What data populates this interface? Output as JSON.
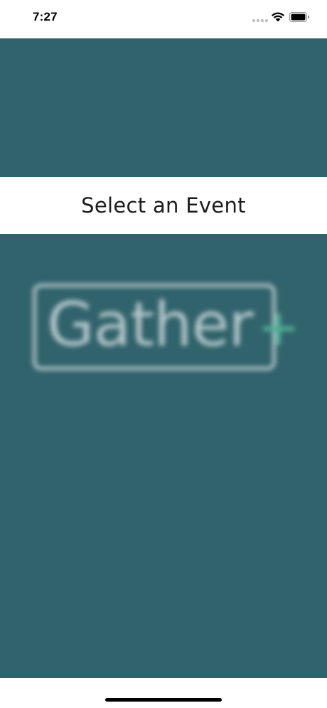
{
  "status_bar": {
    "time": "7:27",
    "icons": [
      "signal-dots-icon",
      "wifi-icon",
      "battery-icon"
    ]
  },
  "event_selector": {
    "label": "Select an Event"
  },
  "logo": {
    "text": "Gather",
    "plus_symbol": "+"
  },
  "colors": {
    "teal_background": "#31636c",
    "logo_text": "#c9d6d8",
    "logo_plus": "#56b89a",
    "bar_background": "#ffffff"
  }
}
